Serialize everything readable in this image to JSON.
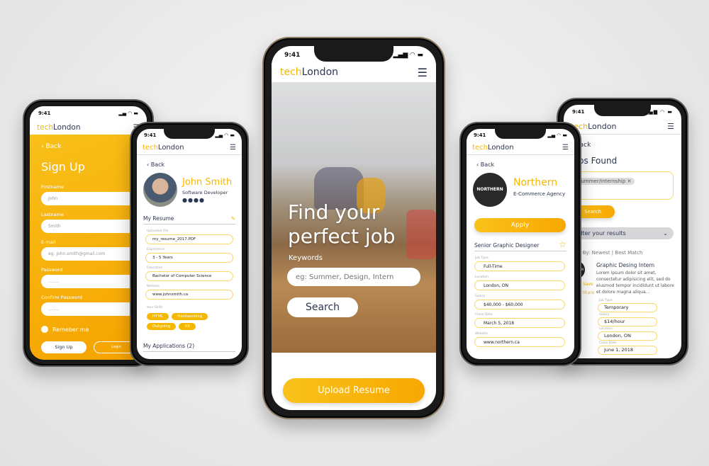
{
  "status_time": "9:41",
  "logo": {
    "tech": "tech",
    "london": "London"
  },
  "menu_icon": "hamburger-icon",
  "signup": {
    "back": "Back",
    "title": "Sign Up",
    "fields": [
      {
        "label": "Firstname",
        "value": "John"
      },
      {
        "label": "Lastname",
        "value": "Smith"
      },
      {
        "label": "E-mail",
        "placeholder": "eg. john.smith@gmail.com"
      },
      {
        "label": "Password",
        "value": "........"
      },
      {
        "label": "Confirm Password",
        "value": "........"
      }
    ],
    "remember": "Remeber me",
    "signup_btn": "Sign Up",
    "login_btn": "Login"
  },
  "profile": {
    "back": "Back",
    "name": "John Smith",
    "role": "Software Developer",
    "social": [
      "facebook-icon",
      "twitter-icon",
      "linkedin-icon",
      "mail-icon"
    ],
    "resume_title": "My Resume",
    "fields": [
      {
        "label": "Uploaded File",
        "value": "my_resume_2017.PDF"
      },
      {
        "label": "Experience",
        "value": "3 - 5 Years"
      },
      {
        "label": "Education",
        "value": "Bachelor of Computer Science"
      },
      {
        "label": "Website",
        "value": "www.johnsmith.ca"
      }
    ],
    "skills_label": "Your Skills",
    "skills": [
      "HTML",
      "Hardworking",
      "Outgoing",
      "UX"
    ],
    "applications": "My Applications (2)"
  },
  "home": {
    "headline1": "Find your",
    "headline2": "perfect job",
    "keywords_label": "Keywords",
    "keywords_placeholder": "eg: Summer, Design, Intern",
    "search": "Search",
    "upload": "Upload Resume"
  },
  "company": {
    "back": "Back",
    "name": "Northern",
    "type": "E-Commerce Agency",
    "logo_text": "NORTHERN",
    "apply": "Apply",
    "job_title": "Senior Graphic Designer",
    "fields": [
      {
        "label": "Job Type",
        "value": "Full-Time"
      },
      {
        "label": "Location",
        "value": "London, ON"
      },
      {
        "label": "Salary",
        "value": "$40,000 - $60,000"
      },
      {
        "label": "Close Date",
        "value": "March 5, 2018"
      },
      {
        "label": "Website",
        "value": "www.northern.ca"
      }
    ]
  },
  "jobs": {
    "back": "Back",
    "title": "Jobs Found",
    "tag": "Summer/Internship",
    "search": "Search",
    "filter": "Filter your results",
    "sort_prefix": "Sort By:",
    "sort_newest": "Newest",
    "sort_best": "Best Match",
    "item": {
      "title": "Graphic Desing Intern",
      "desc": "Lorem ipsum dolor sit amet, consectetur adipisicing elit, sed do eiusmod tempor incididunt ut labore et dolore magna aliqua...",
      "save": "Save",
      "share": "Share",
      "logo_text": "NORTHERN",
      "fields": [
        {
          "label": "Job Type",
          "value": "Temporary"
        },
        {
          "label": "Salary",
          "value": "$14/hour"
        },
        {
          "label": "Location",
          "value": "London, ON"
        },
        {
          "label": "Close Date",
          "value": "June 1, 2018"
        }
      ]
    }
  },
  "colors": {
    "accent": "#f5b800",
    "navy": "#2c3550"
  }
}
